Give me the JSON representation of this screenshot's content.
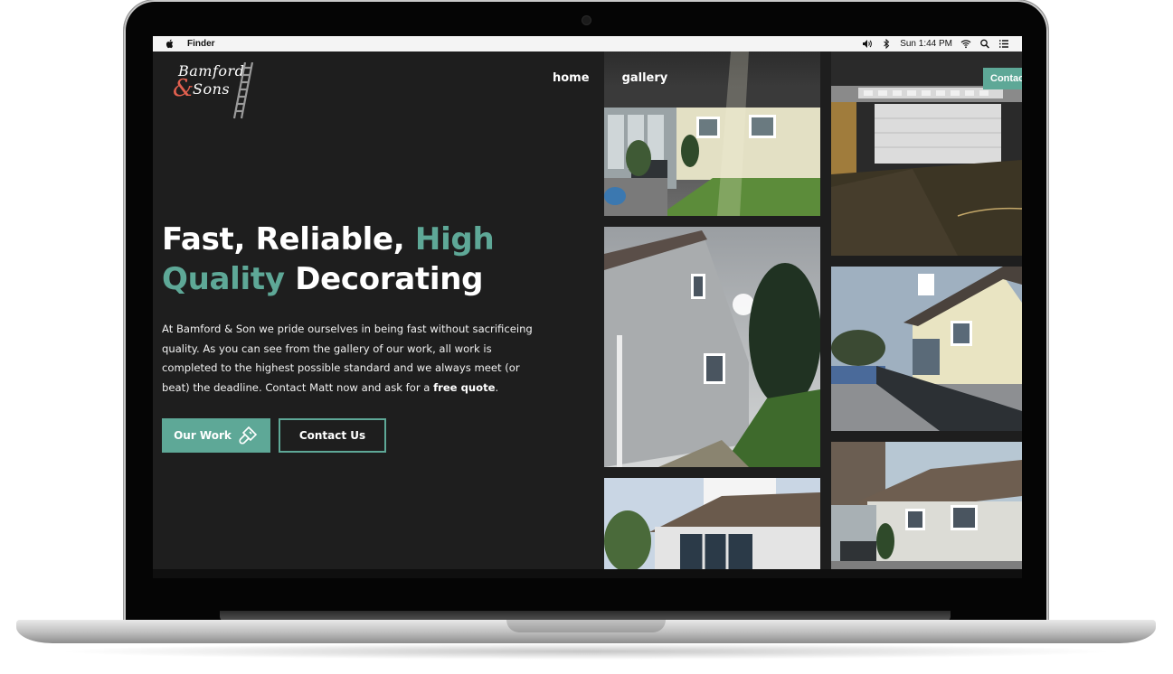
{
  "menubar": {
    "app_name": "Finder",
    "clock": "Sun 1:44 PM"
  },
  "site": {
    "logo": {
      "line1": "Bamford",
      "ampersand": "&",
      "line2": "Sons"
    },
    "nav": {
      "home": "home",
      "gallery": "gallery",
      "contact": "Contact"
    },
    "hero": {
      "title_part1": "Fast, Reliable, ",
      "title_accent1": "High",
      "title_accent2": "Quality",
      "title_part2": " Decorating",
      "text_main": "At Bamford & Son we pride ourselves in being fast without sacrificeing quality. As you can see from the gallery of our work, all work is completed to the highest possible standard and we always meet (or beat) the deadline. Contact Matt now and ask for a ",
      "text_bold": "free quote",
      "text_end": ".",
      "btn_our_work": "Our Work",
      "btn_contact": "Contact Us"
    },
    "colors": {
      "accent": "#5ea897",
      "background": "#1e1e1e",
      "logo_ampersand": "#e2604f"
    }
  }
}
